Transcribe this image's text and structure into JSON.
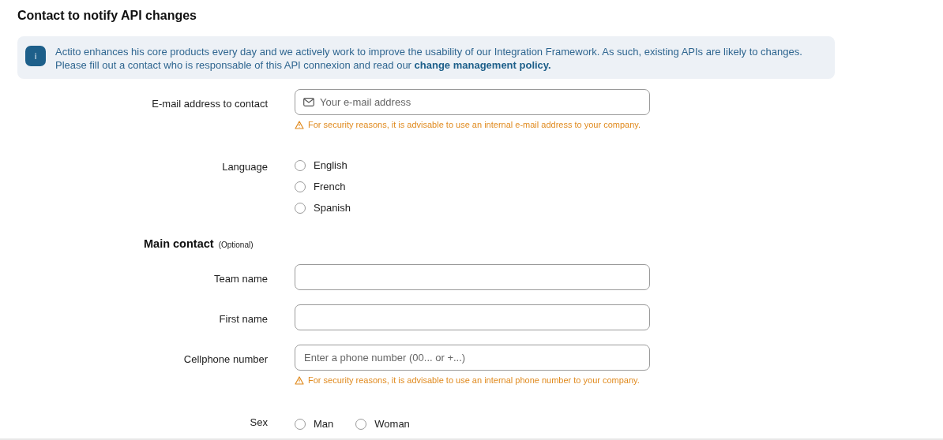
{
  "title": "Contact to notify API changes",
  "info": {
    "icon": "i",
    "text": "Actito enhances his core products every day and we actively work to improve the usability of our Integration Framework. As such, existing APIs are likely to changes. Please fill out a contact who is responsable of this API connexion and read our",
    "link": "change management policy."
  },
  "rows": [
    {
      "kind": "email",
      "label": "E-mail address to contact",
      "placeholder": "Your e-mail address",
      "warning": "For security reasons, it is advisable to use an internal e-mail address to your company."
    },
    {
      "kind": "radio-column",
      "label": "Language",
      "options": [
        {
          "label": "English",
          "selected": false
        },
        {
          "label": "French",
          "selected": false
        },
        {
          "label": "Spanish",
          "selected": false
        }
      ]
    },
    {
      "kind": "heading",
      "label": "Main contact",
      "note": "(Optional)"
    },
    {
      "kind": "input",
      "label": "Team name"
    },
    {
      "kind": "input",
      "label": "First name"
    },
    {
      "kind": "input",
      "label": "Cellphone number",
      "placeholder": "Enter a phone number (00... or +...)",
      "warning": "For security reasons, it is advisable to use an internal phone number to your company."
    },
    {
      "kind": "radio-row",
      "label": "Sex",
      "options": [
        {
          "label": "Man",
          "selected": false
        },
        {
          "label": "Woman",
          "selected": false
        }
      ]
    }
  ]
}
